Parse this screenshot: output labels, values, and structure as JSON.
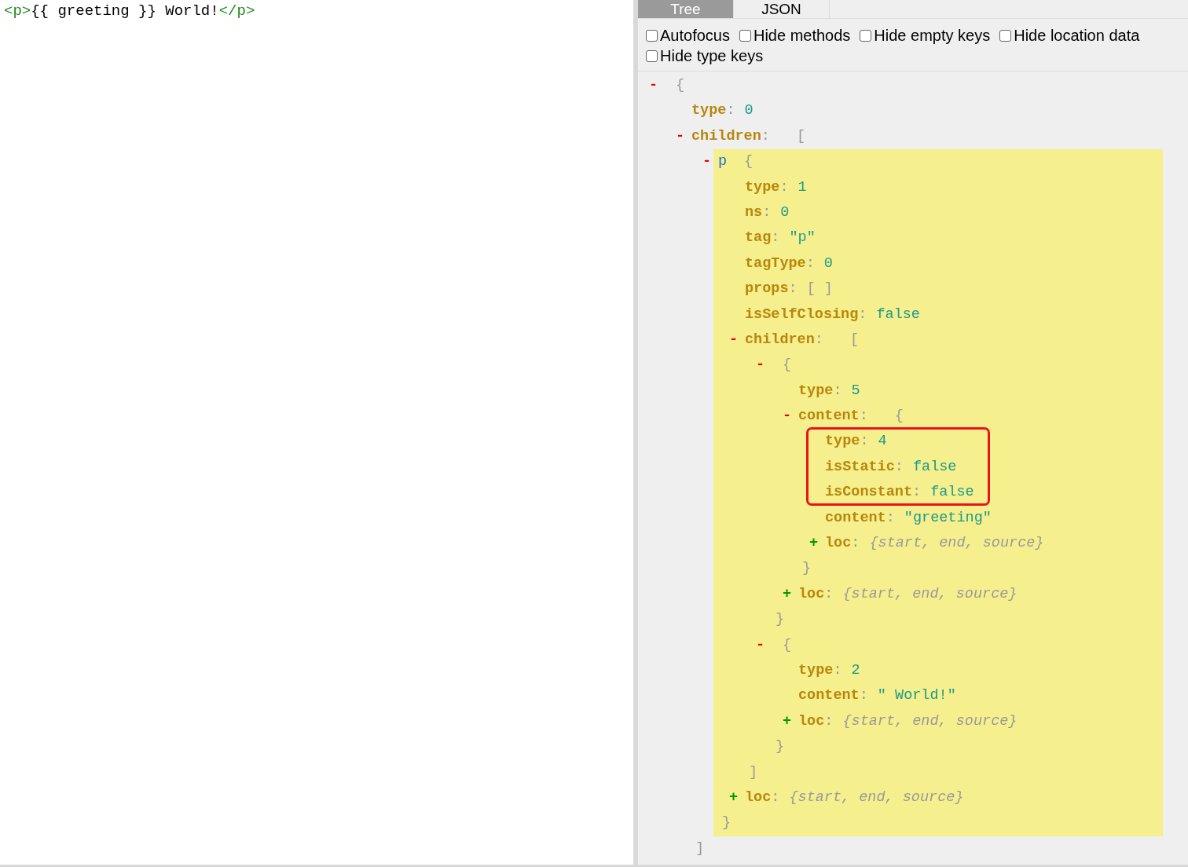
{
  "editor": {
    "code_line": [
      {
        "kind": "tag",
        "text": "<p>"
      },
      {
        "kind": "text",
        "text": "{{ greeting }} World!"
      },
      {
        "kind": "tag",
        "text": "</p>"
      }
    ]
  },
  "tabs": [
    {
      "label": "Tree",
      "selected": true
    },
    {
      "label": "JSON",
      "selected": false
    }
  ],
  "options": [
    {
      "label": "Autofocus",
      "checked": false
    },
    {
      "label": "Hide methods",
      "checked": false
    },
    {
      "label": "Hide empty keys",
      "checked": false
    },
    {
      "label": "Hide location data",
      "checked": false
    },
    {
      "label": "Hide type keys",
      "checked": false
    }
  ],
  "tree": {
    "separator": ":",
    "nodes": [
      {
        "kind": "node",
        "toggle": "-",
        "expanded": true,
        "selected": false,
        "open": "{",
        "children": [
          {
            "kind": "prop",
            "key": "type",
            "value": "0"
          },
          {
            "kind": "node",
            "toggle": "-",
            "expanded": true,
            "selected": false,
            "key": "children",
            "open": "[",
            "close": "]",
            "children": [
              {
                "kind": "node",
                "toggle": "-",
                "expanded": true,
                "selected": true,
                "tag": "p",
                "open": "{",
                "close": "}",
                "children": [
                  {
                    "kind": "prop",
                    "key": "type",
                    "value": "1"
                  },
                  {
                    "kind": "prop",
                    "key": "ns",
                    "value": "0"
                  },
                  {
                    "kind": "prop",
                    "key": "tag",
                    "value": "\"p\""
                  },
                  {
                    "kind": "prop",
                    "key": "tagType",
                    "value": "0"
                  },
                  {
                    "kind": "empty",
                    "key": "props",
                    "value": "[ ]"
                  },
                  {
                    "kind": "prop",
                    "key": "isSelfClosing",
                    "value": "false"
                  },
                  {
                    "kind": "node",
                    "toggle": "-",
                    "expanded": true,
                    "selected": false,
                    "key": "children",
                    "open": "[",
                    "close": "]",
                    "children": [
                      {
                        "kind": "node",
                        "toggle": "-",
                        "expanded": true,
                        "selected": false,
                        "open": "{",
                        "close": "}",
                        "children": [
                          {
                            "kind": "prop",
                            "key": "type",
                            "value": "5"
                          },
                          {
                            "kind": "node",
                            "toggle": "-",
                            "expanded": true,
                            "selected": false,
                            "key": "content",
                            "open": "{",
                            "close": "}",
                            "children": [
                              {
                                "kind": "annotation",
                                "children": [
                                  {
                                    "kind": "prop",
                                    "key": "type",
                                    "value": "4"
                                  },
                                  {
                                    "kind": "prop",
                                    "key": "isStatic",
                                    "value": "false"
                                  },
                                  {
                                    "kind": "prop",
                                    "key": "isConstant",
                                    "value": "false"
                                  }
                                ]
                              },
                              {
                                "kind": "prop",
                                "key": "content",
                                "value": "\"greeting\""
                              },
                              {
                                "kind": "collapsed",
                                "toggle": "+",
                                "expanded": false,
                                "key": "loc",
                                "summary": "{start, end, source}"
                              }
                            ]
                          },
                          {
                            "kind": "collapsed",
                            "toggle": "+",
                            "expanded": false,
                            "key": "loc",
                            "summary": "{start, end, source}"
                          }
                        ]
                      },
                      {
                        "kind": "node",
                        "toggle": "-",
                        "expanded": true,
                        "selected": false,
                        "open": "{",
                        "close": "}",
                        "children": [
                          {
                            "kind": "prop",
                            "key": "type",
                            "value": "2"
                          },
                          {
                            "kind": "prop",
                            "key": "content",
                            "value": "\" World!\""
                          },
                          {
                            "kind": "collapsed",
                            "toggle": "+",
                            "expanded": false,
                            "key": "loc",
                            "summary": "{start, end, source}"
                          }
                        ]
                      }
                    ]
                  },
                  {
                    "kind": "collapsed",
                    "toggle": "+",
                    "expanded": false,
                    "key": "loc",
                    "summary": "{start, end, source}"
                  }
                ]
              }
            ]
          }
        ]
      }
    ]
  }
}
